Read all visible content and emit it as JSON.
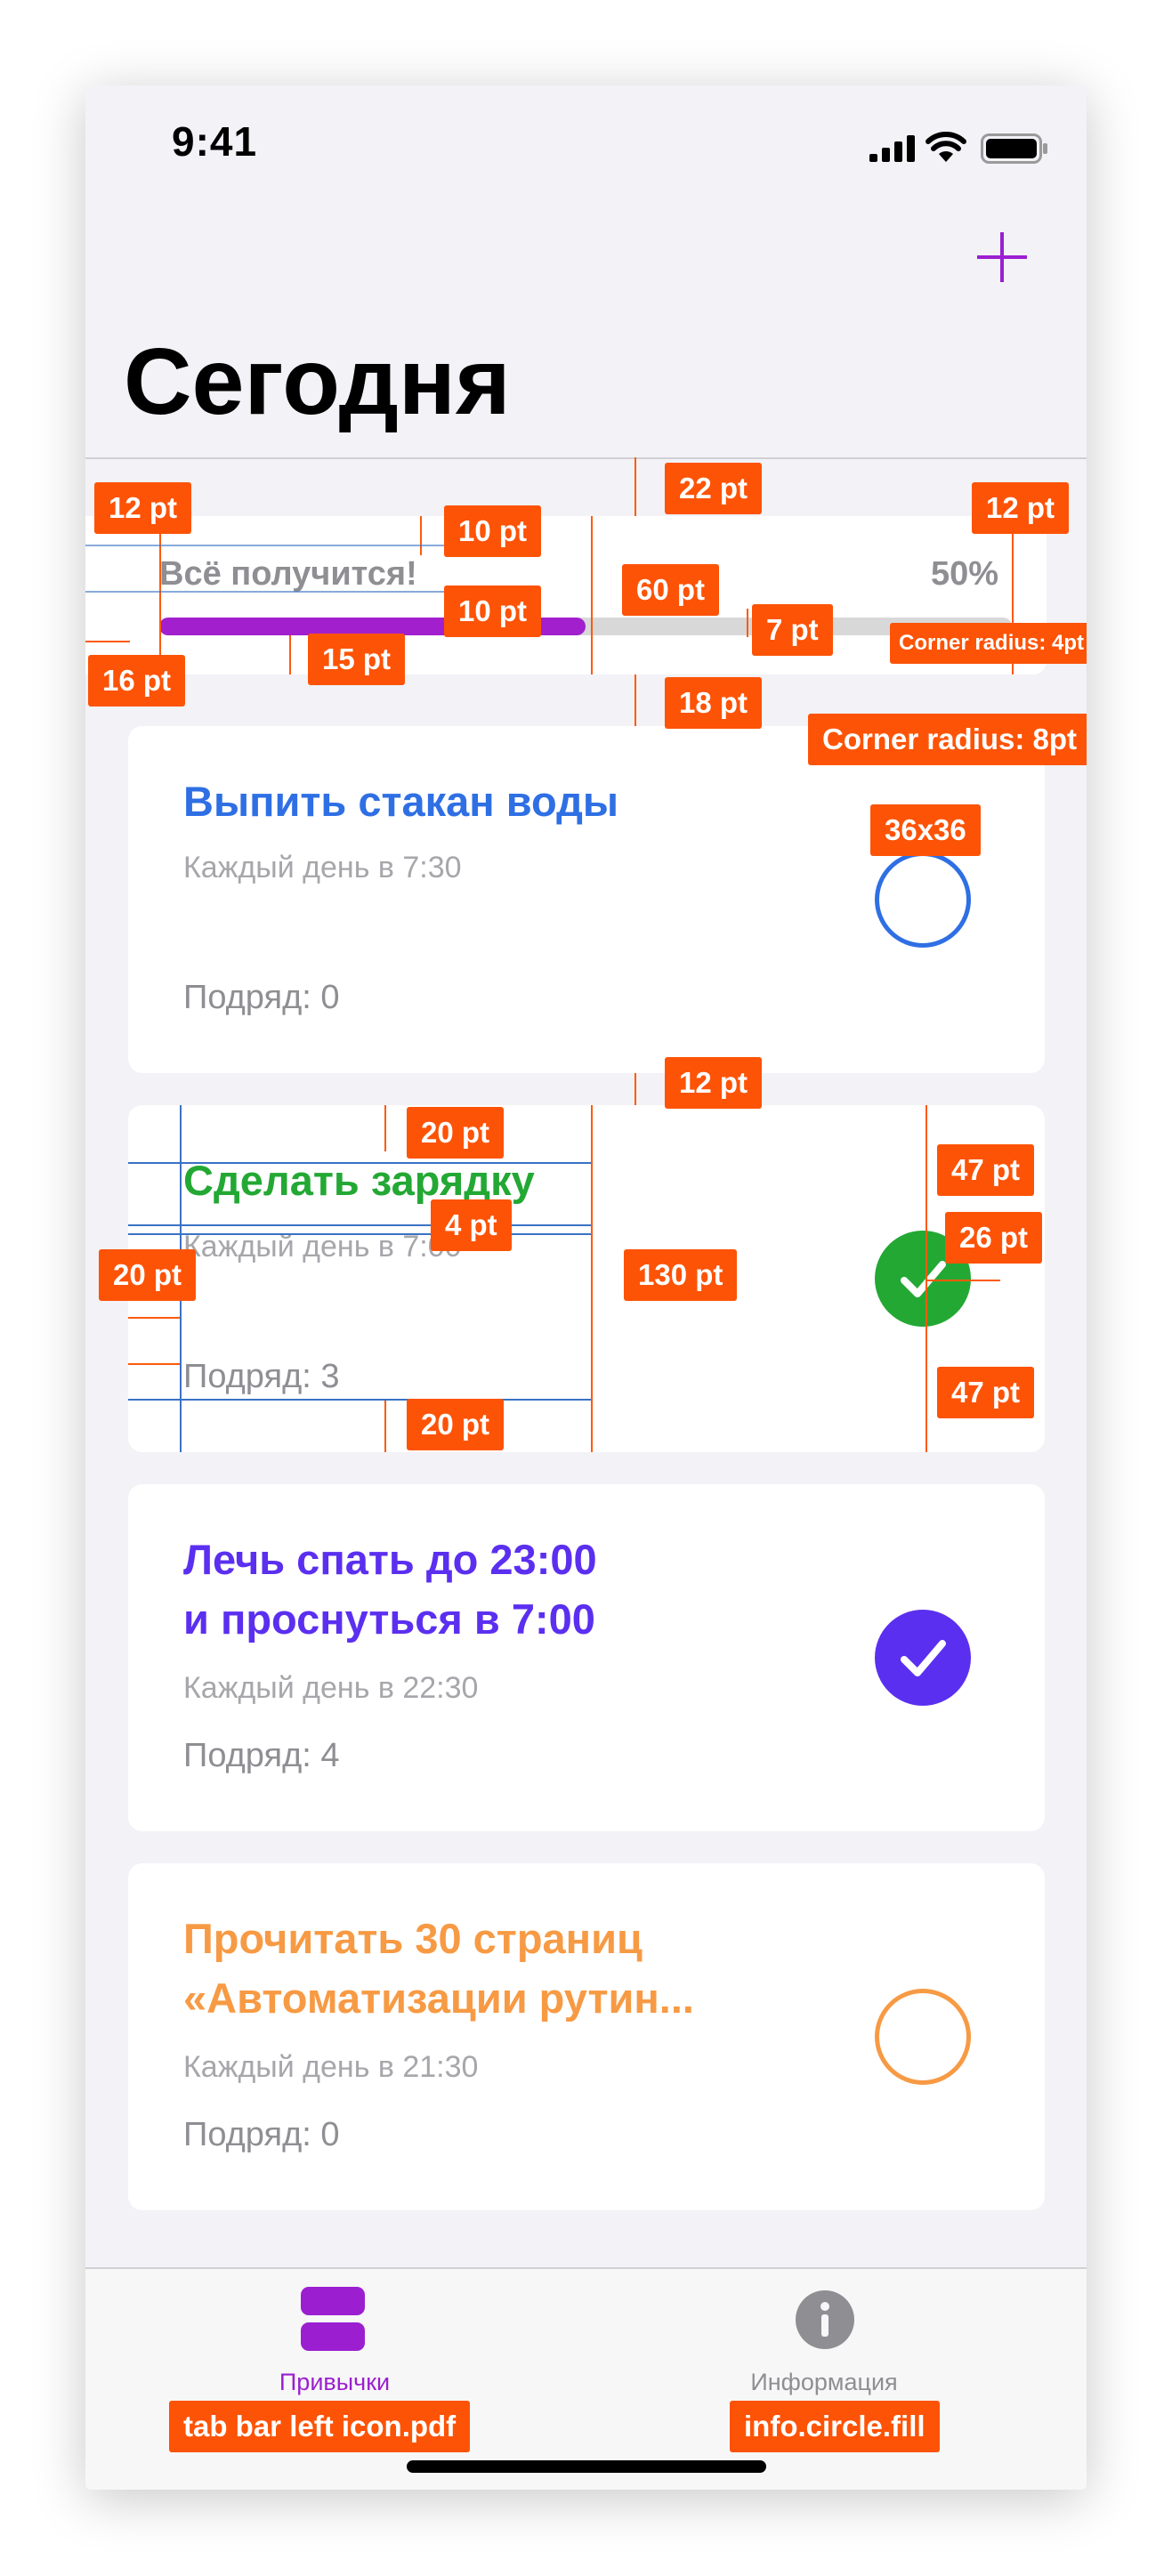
{
  "status_bar": {
    "time": "9:41"
  },
  "header": {
    "title": "Сегодня",
    "add_icon": "plus-icon",
    "accent": "#9b1fd1"
  },
  "progress": {
    "label": "Всё получится!",
    "percent_text": "50%",
    "fraction": 0.5,
    "fill_color": "#a21fce"
  },
  "habits": [
    {
      "title": "Выпить стакан воды",
      "schedule": "Каждый день в 7:30",
      "streak": "Подряд: 0",
      "color": "#2f6fe4",
      "done": false
    },
    {
      "title": "Сделать зарядку",
      "schedule": "Каждый день в 7:00",
      "streak": "Подряд: 3",
      "color": "#23a834",
      "done": true
    },
    {
      "title": "Лечь спать до 23:00\nи проснуться в 7:00",
      "schedule": "Каждый день в 22:30",
      "streak": "Подряд: 4",
      "color": "#5b2ff0",
      "done": true
    },
    {
      "title": "Прочитать 30 страниц\n«Автоматизации рутин...",
      "schedule": "Каждый день в 21:30",
      "streak": "Подряд: 0",
      "color": "#f79a44",
      "done": false
    }
  ],
  "tab_bar": {
    "active_color": "#9b1fd1",
    "inactive_color": "#8e8e93",
    "tabs": [
      {
        "label": "Привычки",
        "icon": "habits-icon",
        "active": true
      },
      {
        "label": "Информация",
        "icon": "info-circle-fill-icon",
        "active": false
      }
    ]
  },
  "annotations": {
    "progress_left_margin": "12 pt",
    "progress_right_margin": "12 pt",
    "progress_top_spacing": "22 pt",
    "progress_label_gap": "10 pt",
    "progress_bar_gap": "10 pt",
    "progress_bottom_padding": "15 pt",
    "progress_bar_inset": "16 pt",
    "progress_label_height": "60 pt",
    "progress_bar_height": "7 pt",
    "progress_bar_radius": "Corner radius: 4pt",
    "progress_bottom_spacing": "18 pt",
    "card_radius": "Corner radius: 8pt",
    "check_size": "36x36",
    "card_spacing": "12 pt",
    "card_top_padding": "20 pt",
    "card_title_gap": "4 pt",
    "card_left_padding": "20 pt",
    "card_text_width": "130 pt",
    "card_bottom_padding": "20 pt",
    "check_top": "47 pt",
    "check_right": "26 pt",
    "check_bottom": "47 pt",
    "tab_left_asset": "tab bar left icon.pdf",
    "tab_right_asset": "info.circle.fill"
  }
}
